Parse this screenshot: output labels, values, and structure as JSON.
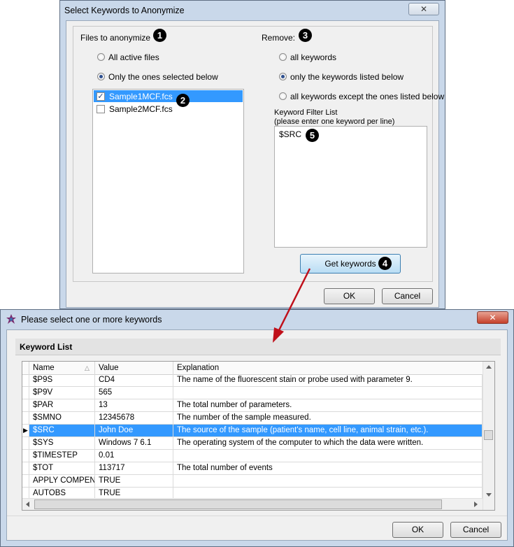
{
  "dialog1": {
    "title": "Select Keywords to Anonymize",
    "close_glyph": "✕",
    "files_label": "Files to anonymize",
    "badge1": "1",
    "radio_all_files": "All active files",
    "radio_selected_files": "Only the ones selected below",
    "files": [
      {
        "name": "Sample1MCF.fcs",
        "checked": true
      },
      {
        "name": "Sample2MCF.fcs",
        "checked": false
      }
    ],
    "badge2": "2",
    "remove_label": "Remove:",
    "badge3": "3",
    "radio_all_keywords": "all keywords",
    "radio_only_listed": "only the keywords listed below",
    "radio_all_except": "all keywords except the ones listed below",
    "filter_label_line1": "Keyword Filter List",
    "filter_label_line2": "(please enter one keyword per line)",
    "filter_value": "$SRC",
    "badge5": "5",
    "get_keywords_button": "Get keywords",
    "badge4": "4",
    "ok_button": "OK",
    "cancel_button": "Cancel"
  },
  "dialog2": {
    "title": "Please select one or more keywords",
    "close_glyph": "✕",
    "section_title": "Keyword List",
    "columns": [
      "Name",
      "Value",
      "Explanation"
    ],
    "sort_glyph": "△",
    "rows": [
      {
        "name": "$P9S",
        "value": "CD4",
        "explanation": "The name of the fluorescent stain or probe used with parameter 9."
      },
      {
        "name": "$P9V",
        "value": "565",
        "explanation": ""
      },
      {
        "name": "$PAR",
        "value": "13",
        "explanation": "The total number of parameters."
      },
      {
        "name": "$SMNO",
        "value": "12345678",
        "explanation": "The number of the sample measured."
      },
      {
        "name": "$SRC",
        "value": "John Doe",
        "explanation": "The source of the sample (patient's name, cell line, animal strain, etc.).",
        "selected": true,
        "indicator": "▶"
      },
      {
        "name": "$SYS",
        "value": "Windows 7 6.1",
        "explanation": "The operating system of the computer to which the data were written."
      },
      {
        "name": "$TIMESTEP",
        "value": "0.01",
        "explanation": ""
      },
      {
        "name": "$TOT",
        "value": "113717",
        "explanation": "The total number of events"
      },
      {
        "name": "APPLY COMPEN...",
        "value": "TRUE",
        "explanation": ""
      },
      {
        "name": "AUTOBS",
        "value": "TRUE",
        "explanation": ""
      }
    ],
    "ok_button": "OK",
    "cancel_button": "Cancel"
  },
  "colors": {
    "selection": "#3399ff",
    "arrow": "#c0101a",
    "frame": "#c9d8ea"
  }
}
